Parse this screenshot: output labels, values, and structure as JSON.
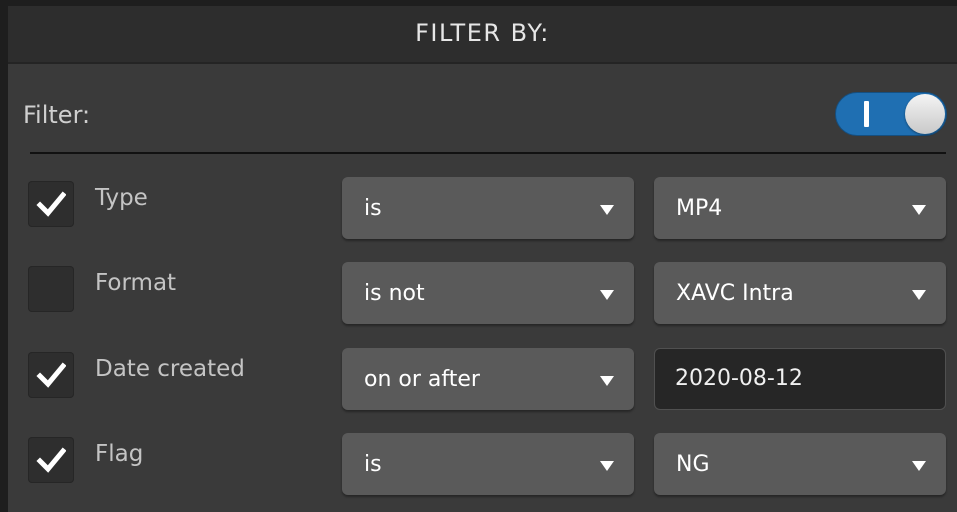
{
  "header": {
    "title": "FILTER BY:"
  },
  "filter": {
    "label": "Filter:",
    "enabled": true,
    "toggle_mark": "I"
  },
  "rows": [
    {
      "label": "Type",
      "checked": true,
      "operator": "is",
      "value": "MP4",
      "value_kind": "dropdown"
    },
    {
      "label": "Format",
      "checked": false,
      "operator": "is not",
      "value": "XAVC Intra",
      "value_kind": "dropdown"
    },
    {
      "label": "Date created",
      "checked": true,
      "operator": "on or after",
      "value": "2020-08-12",
      "value_kind": "text"
    },
    {
      "label": "Flag",
      "checked": true,
      "operator": "is",
      "value": "NG",
      "value_kind": "dropdown"
    }
  ],
  "colors": {
    "toggle_on": "#1f6fb2",
    "panel": "#3a3a3a",
    "header": "#2d2d2d",
    "dropdown": "#5a5a5a"
  }
}
